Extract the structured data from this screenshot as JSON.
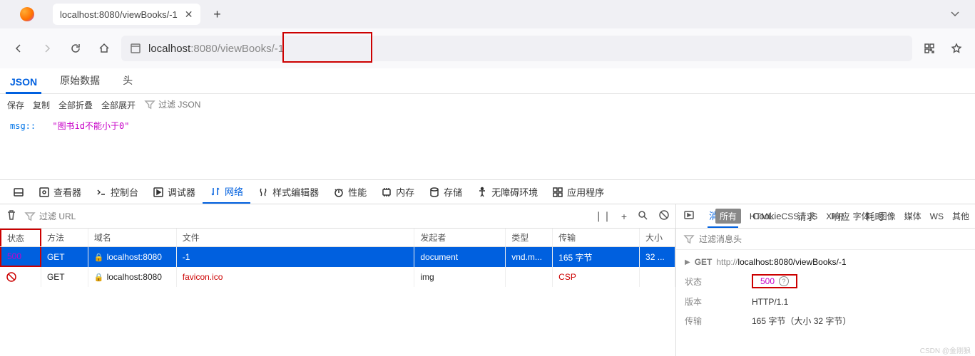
{
  "tab": {
    "title": "localhost:8080/viewBooks/-1"
  },
  "url": {
    "host": "localhost",
    "rest": ":8080/viewBooks/-1"
  },
  "json_tabs": {
    "json": "JSON",
    "raw": "原始数据",
    "head": "头"
  },
  "json_toolbar": {
    "save": "保存",
    "copy": "复制",
    "collapse": "全部折叠",
    "expand": "全部展开",
    "filter_ph": "过滤 JSON"
  },
  "json_content": {
    "key": "msg::",
    "value": "\"图书id不能小于0\""
  },
  "devtools_tabs": {
    "inspect": "查看器",
    "console": "控制台",
    "debugger": "调试器",
    "network": "网络",
    "style": "样式编辑器",
    "perf": "性能",
    "memory": "内存",
    "storage": "存储",
    "a11y": "无障碍环境",
    "app": "应用程序"
  },
  "net_filter_ph": "过滤 URL",
  "net_filters": {
    "all": "所有",
    "html": "HTML",
    "css": "CSS",
    "js": "JS",
    "xhr": "XHR",
    "font": "字体",
    "img": "图像",
    "media": "媒体",
    "ws": "WS",
    "other": "其他"
  },
  "net_head": {
    "status": "状态",
    "method": "方法",
    "domain": "域名",
    "file": "文件",
    "init": "发起者",
    "type": "类型",
    "trans": "传输",
    "size": "大小"
  },
  "net_rows": [
    {
      "status": "500",
      "method": "GET",
      "domain": "localhost:8080",
      "file": "-1",
      "init": "document",
      "type": "vnd.m...",
      "trans": "165 字节",
      "size": "32 ..."
    },
    {
      "status": "blocked",
      "method": "GET",
      "domain": "localhost:8080",
      "file": "favicon.ico",
      "init": "img",
      "type": "",
      "trans": "CSP",
      "size": ""
    }
  ],
  "detail_tabs": {
    "headers": "消息头",
    "cookie": "Cookie",
    "req": "请求",
    "resp": "响应",
    "timing": "耗时"
  },
  "detail_filter_ph": "过滤消息头",
  "detail": {
    "method": "GET",
    "url_pre": "http://",
    "url_host": "localhost:8080/viewBooks/-1",
    "k_status": "状态",
    "v_status": "500",
    "k_version": "版本",
    "v_version": "HTTP/1.1",
    "k_trans": "传输",
    "v_trans": "165 字节（大小 32 字节）"
  },
  "watermark": "CSDN @金刚狼"
}
